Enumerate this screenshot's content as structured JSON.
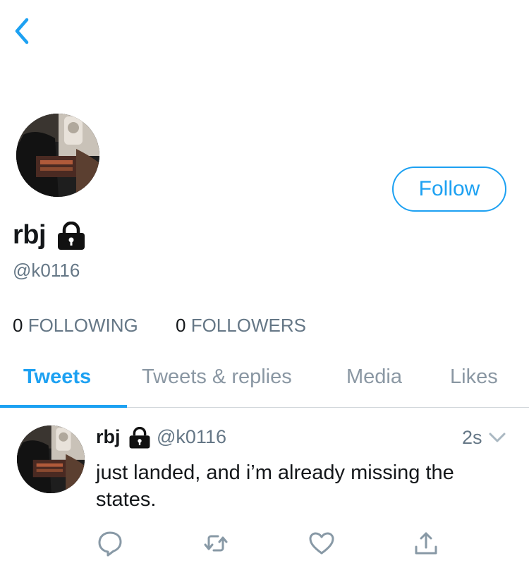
{
  "nav": {
    "back_icon": "chevron-left-icon"
  },
  "profile": {
    "display_name": "rbj",
    "handle": "@k0116",
    "follow_label": "Follow",
    "following_count": "0",
    "following_label": "FOLLOWING",
    "followers_count": "0",
    "followers_label": "FOLLOWERS",
    "protected_icon": "lock-icon"
  },
  "tabs": [
    {
      "label": "Tweets",
      "active": true
    },
    {
      "label": "Tweets & replies",
      "active": false
    },
    {
      "label": "Media",
      "active": false
    },
    {
      "label": "Likes",
      "active": false
    }
  ],
  "tweet": {
    "name": "rbj",
    "handle": "@k0116",
    "time": "2s",
    "text": "just landed, and i’m already missing the states.",
    "actions": [
      "reply-icon",
      "retweet-icon",
      "like-icon",
      "share-icon"
    ]
  },
  "colors": {
    "accent": "#1da1f2",
    "secondary_text": "#657786",
    "primary_text": "#14171a",
    "divider": "#d3d8dc"
  }
}
